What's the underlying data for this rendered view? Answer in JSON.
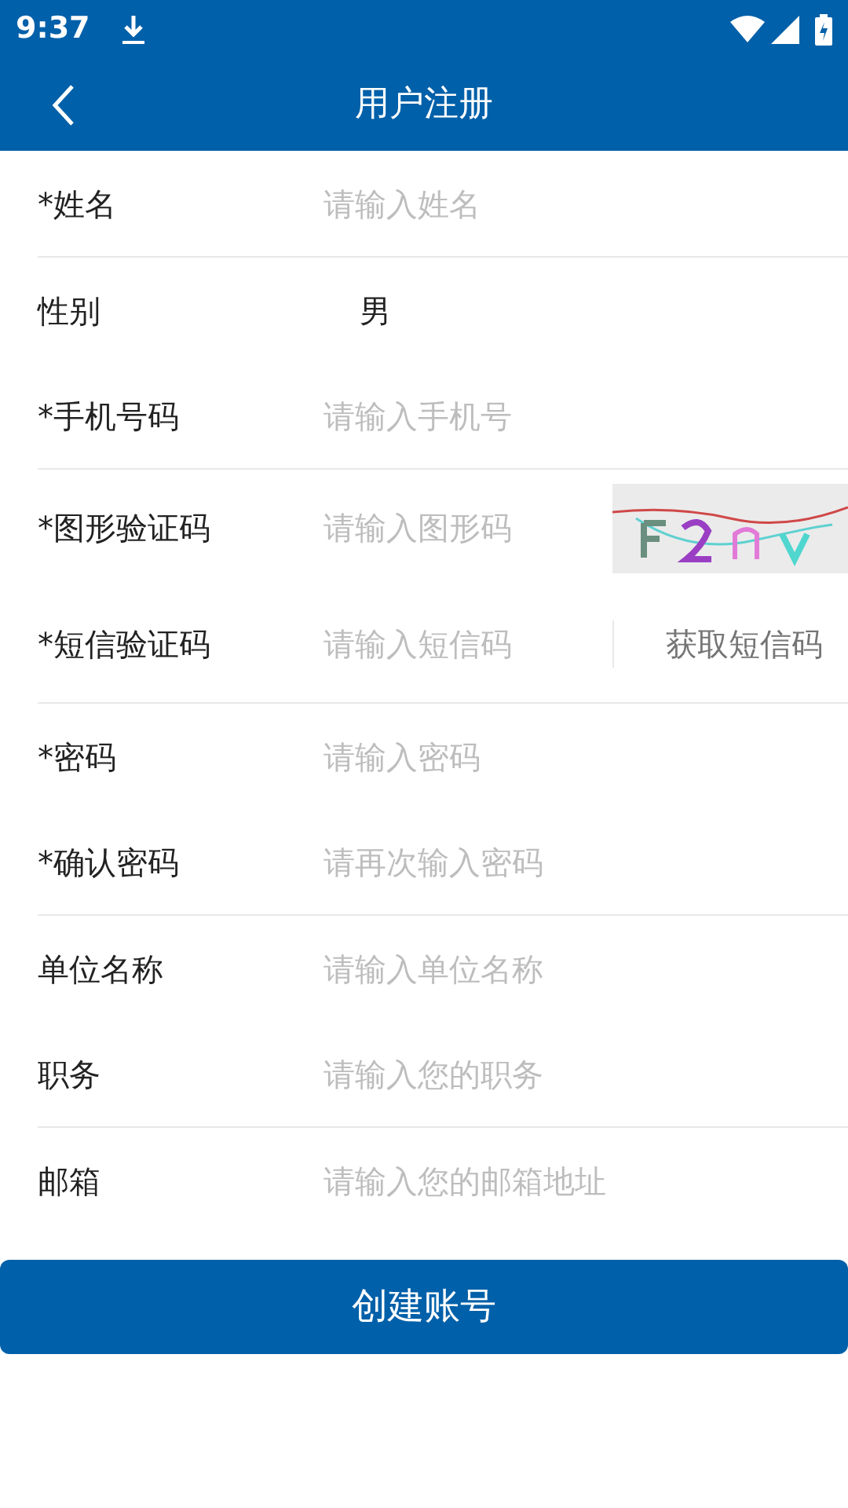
{
  "status_bar": {
    "time": "9:37"
  },
  "header": {
    "title": "用户注册"
  },
  "fields": [
    {
      "kind": "input",
      "label": "*姓名",
      "placeholder": "请输入姓名",
      "divider": true
    },
    {
      "kind": "value",
      "label": "性别",
      "value": "男",
      "divider": false
    },
    {
      "kind": "input",
      "label": "*手机号码",
      "placeholder": "请输入手机号",
      "divider": true
    },
    {
      "kind": "captcha",
      "label": "*图形验证码",
      "placeholder": "请输入图形码",
      "divider": false
    },
    {
      "kind": "sms",
      "label": "*短信验证码",
      "placeholder": "请输入短信码",
      "button": "获取短信码",
      "divider": true
    },
    {
      "kind": "input",
      "label": "*密码",
      "placeholder": "请输入密码",
      "divider": false
    },
    {
      "kind": "input",
      "label": "*确认密码",
      "placeholder": "请再次输入密码",
      "divider": true
    },
    {
      "kind": "input",
      "label": "单位名称",
      "placeholder": "请输入单位名称",
      "divider": false
    },
    {
      "kind": "input",
      "label": "职务",
      "placeholder": "请输入您的职务",
      "divider": true
    },
    {
      "kind": "input",
      "label": "邮箱",
      "placeholder": "请输入您的邮箱地址",
      "divider": false
    }
  ],
  "submit": "创建账号"
}
